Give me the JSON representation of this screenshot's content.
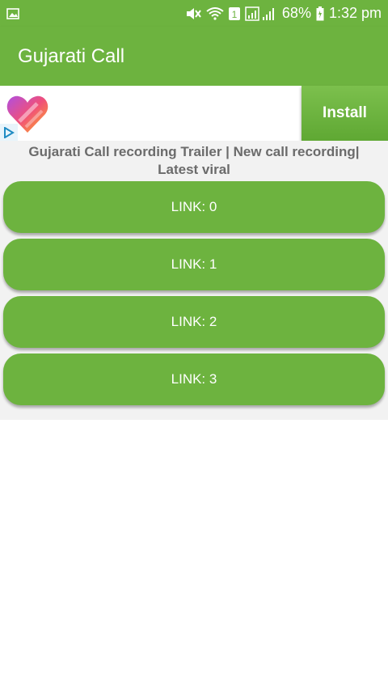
{
  "status_bar": {
    "battery": "68%",
    "time": "1:32 pm",
    "sim_label": "1",
    "icons": [
      "gallery-icon",
      "mute-icon",
      "wifi-icon",
      "sim-icon",
      "signal-icon",
      "battery-icon"
    ]
  },
  "app_bar": {
    "title": "Gujarati Call",
    "color": "#6db33f"
  },
  "ad": {
    "install_label": "Install",
    "logo_icon": "heart-logo-icon",
    "choices_icon": "ad-choices-icon"
  },
  "main": {
    "heading": "Gujarati Call recording Trailer | New call recording| Latest viral",
    "links": [
      {
        "label": "LINK: 0"
      },
      {
        "label": "LINK: 1"
      },
      {
        "label": "LINK: 2"
      },
      {
        "label": "LINK: 3"
      }
    ]
  }
}
